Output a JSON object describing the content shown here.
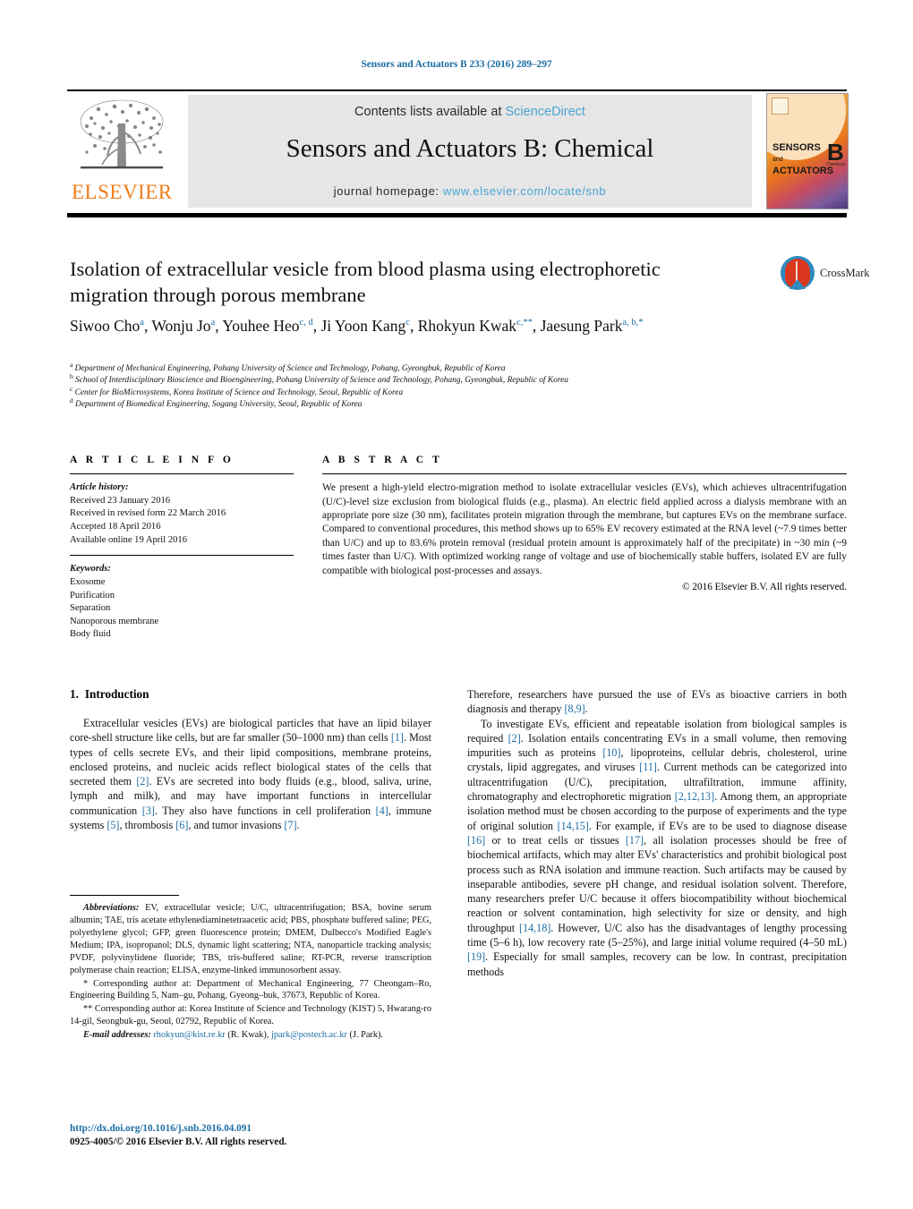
{
  "running_head": "Sensors and Actuators B 233 (2016) 289–297",
  "masthead": {
    "contents_prefix": "Contents lists available at ",
    "sciencedirect": "ScienceDirect",
    "journal_title": "Sensors and Actuators B: Chemical",
    "homepage_prefix": "journal homepage: ",
    "homepage_url": "www.elsevier.com/locate/snb",
    "publisher": "ELSEVIER",
    "cover": {
      "line1": "SENSORS",
      "and": "and",
      "line2": "ACTUATORS",
      "letter": "B",
      "sub": "Chemical"
    },
    "colors": {
      "link": "#4ba3d3",
      "elsevier_orange": "#ef7d1a",
      "box_gray": "#e6e6e6"
    }
  },
  "article": {
    "title": "Isolation of extracellular vesicle from blood plasma using electrophoretic migration through porous membrane",
    "crossmark_label": "CrossMark",
    "authors_line1": "Siwoo Cho",
    "authors": [
      {
        "name": "Siwoo Cho",
        "marks": "a"
      },
      {
        "name": "Wonju Jo",
        "marks": "a"
      },
      {
        "name": "Youhee Heo",
        "marks": "c, d"
      },
      {
        "name": "Ji Yoon Kang",
        "marks": "c"
      },
      {
        "name": "Rhokyun Kwak",
        "marks": "c,**"
      },
      {
        "name": "Jaesung Park",
        "marks": "a, b,*"
      }
    ],
    "affiliations": [
      {
        "mark": "a",
        "text": "Department of Mechanical Engineering, Pohang University of Science and Technology, Pohang, Gyeongbuk, Republic of Korea"
      },
      {
        "mark": "b",
        "text": "School of Interdisciplinary Bioscience and Bioengineering, Pohang University of Science and Technology, Pohang, Gyeongbuk, Republic of Korea"
      },
      {
        "mark": "c",
        "text": "Center for BioMicrosystems, Korea Institute of Science and Technology, Seoul, Republic of Korea"
      },
      {
        "mark": "d",
        "text": "Department of Biomedical Engineering, Sogang University, Seoul, Republic of Korea"
      }
    ]
  },
  "article_info": {
    "heading": "A R T I C L E    I N F O",
    "history_label": "Article history:",
    "history": [
      "Received 23 January 2016",
      "Received in revised form 22 March 2016",
      "Accepted 18 April 2016",
      "Available online 19 April 2016"
    ],
    "keywords_label": "Keywords:",
    "keywords": [
      "Exosome",
      "Purification",
      "Separation",
      "Nanoporous membrane",
      "Body fluid"
    ]
  },
  "abstract": {
    "heading": "A B S T R A C T",
    "text": "We present a high-yield electro-migration method to isolate extracellular vesicles (EVs), which achieves ultracentrifugation (U/C)-level size exclusion from biological fluids (e.g., plasma). An electric field applied across a dialysis membrane with an appropriate pore size (30 nm), facilitates protein migration through the membrane, but captures EVs on the membrane surface. Compared to conventional procedures, this method shows up to 65% EV recovery estimated at the RNA level (~7.9 times better than U/C) and up to 83.6% protein removal (residual protein amount is approximately half of the precipitate) in ~30 min (~9 times faster than U/C). With optimized working range of voltage and use of biochemically stable buffers, isolated EV are fully compatible with biological post-processes and assays.",
    "copyright": "© 2016 Elsevier B.V. All rights reserved."
  },
  "body": {
    "section_number": "1.",
    "section_title": "Introduction",
    "left_paragraph_1": "Extracellular vesicles (EVs) are biological particles that have an lipid bilayer core-shell structure like cells, but are far smaller (50–1000 nm) than cells [1]. Most types of cells secrete EVs, and their lipid compositions, membrane proteins, enclosed proteins, and nucleic acids reflect biological states of the cells that secreted them [2]. EVs are secreted into body fluids (e.g., blood, saliva, urine, lymph and milk), and may have important functions in intercellular communication [3]. They also have functions in cell proliferation [4], immune systems [5], thrombosis [6], and tumor invasions [7].",
    "right_paragraph_1": "Therefore, researchers have pursued the use of EVs as bioactive carriers in both diagnosis and therapy [8,9].",
    "right_paragraph_2": "To investigate EVs, efficient and repeatable isolation from biological samples is required [2]. Isolation entails concentrating EVs in a small volume, then removing impurities such as proteins [10], lipoproteins, cellular debris, cholesterol, urine crystals, lipid aggregates, and viruses [11]. Current methods can be categorized into ultracentrifugation (U/C), precipitation, ultrafiltration, immune affinity, chromatography and electrophoretic migration [2,12,13]. Among them, an appropriate isolation method must be chosen according to the purpose of experiments and the type of original solution [14,15]. For example, if EVs are to be used to diagnose disease [16] or to treat cells or tissues [17], all isolation processes should be free of biochemical artifacts, which may alter EVs' characteristics and prohibit biological post process such as RNA isolation and immune reaction. Such artifacts may be caused by inseparable antibodies, severe pH change, and residual isolation solvent. Therefore, many researchers prefer U/C because it offers biocompatibility without biochemical reaction or solvent contamination, high selectivity for size or density, and high throughput [14,18]. However, U/C also has the disadvantages of lengthy processing time (5–6 h), low recovery rate (5–25%), and large initial volume required (4–50 mL) [19]. Especially for small samples, recovery can be low. In contrast, precipitation methods"
  },
  "footnotes": {
    "abbreviations_label": "Abbreviations:",
    "abbreviations_text": "EV, extracellular vesicle; U/C, ultracentrifugation; BSA, bovine serum albumin; TAE, tris acetate ethylenediaminetetraacetic acid; PBS, phosphate buffered saline; PEG, polyethylene glycol; GFP, green fluorescence protein; DMEM, Dulbecco's Modified Eagle's Medium; IPA, isopropanol; DLS, dynamic light scattering; NTA, nanoparticle tracking analysis; PVDF, polyvinylidene fluoride; TBS, tris-buffered saline; RT-PCR, reverse transcription polymerase chain reaction; ELISA, enzyme-linked immunosorbent assay.",
    "corresponding_1": "* Corresponding author at: Department of Mechanical Engineering, 77 Cheongam–Ro, Engineering Building 5, Nam–gu, Pohang, Gyeong–buk, 37673, Republic of Korea.",
    "corresponding_2": "** Corresponding author at: Korea Institute of Science and Technology (KIST) 5, Hwarang-ro 14-gil, Seongbuk-gu, Seoul, 02792, Republic of Korea.",
    "email_label": "E-mail addresses:",
    "email_1": "rhokyun@kist.re.kr",
    "email_1_owner": "(R. Kwak),",
    "email_2": "jpark@postech.ac.kr",
    "email_2_owner": "(J. Park)."
  },
  "doi_block": {
    "doi_url": "http://dx.doi.org/10.1016/j.snb.2016.04.091",
    "issn_line": "0925-4005/© 2016 Elsevier B.V. All rights reserved."
  }
}
